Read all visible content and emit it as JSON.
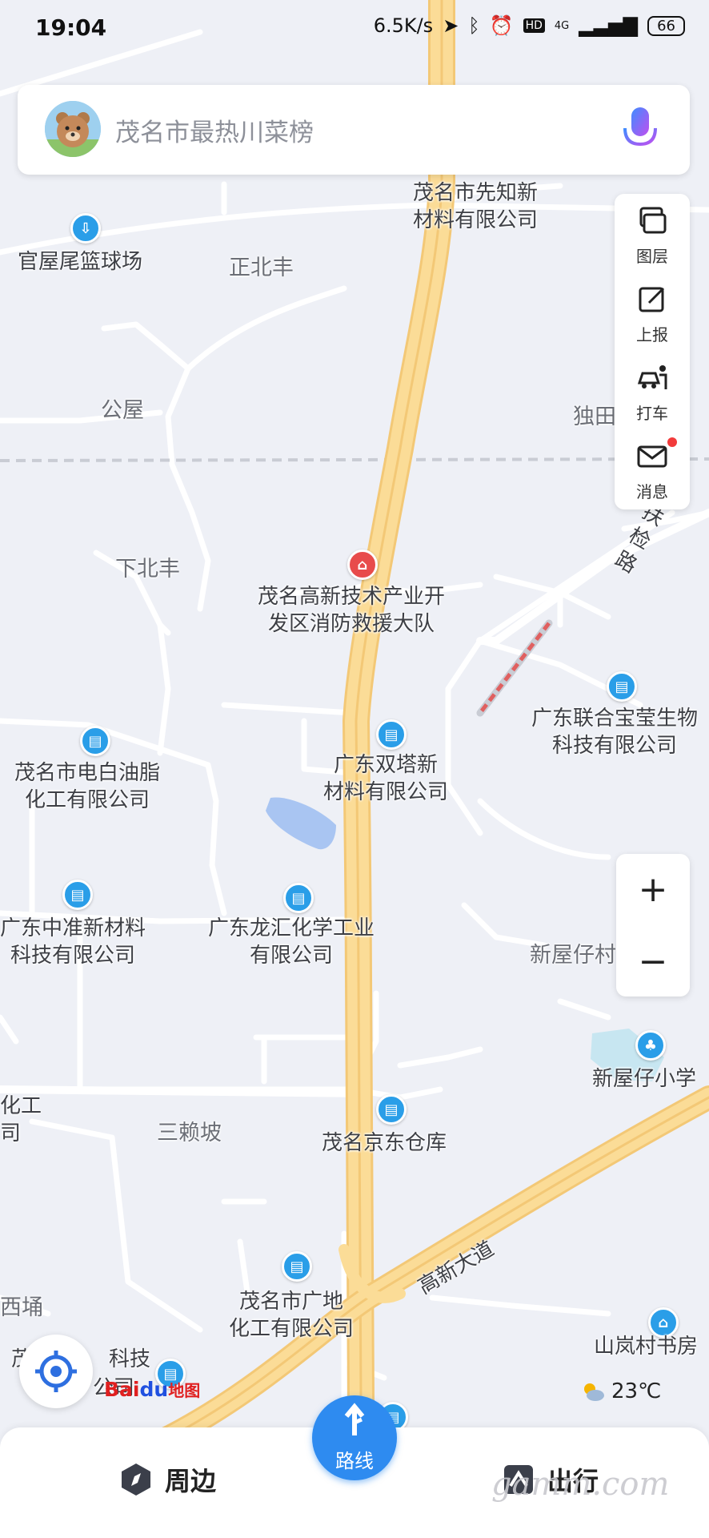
{
  "status_bar": {
    "time": "19:04",
    "net_speed": "6.5K/s",
    "network": "4G",
    "battery": "66"
  },
  "search": {
    "placeholder": "茂名市最热川菜榜"
  },
  "tools": [
    {
      "label": "图层",
      "icon": "layers-icon"
    },
    {
      "label": "上报",
      "icon": "report-icon"
    },
    {
      "label": "打车",
      "icon": "taxi-icon"
    },
    {
      "label": "消息",
      "icon": "message-icon",
      "badge": true
    }
  ],
  "map_labels": {
    "poi_1a": "茂名市先知新",
    "poi_1b": "材料有限公司",
    "court": "官屋尾篮球场",
    "place_zhengbeifeng": "正北丰",
    "place_gongwu": "公屋",
    "place_dutian": "独田",
    "road_fujian": "扶检路",
    "place_xiabeifeng": "下北丰",
    "fire_a": "茂名高新技术产业开",
    "fire_b": "发区消防救援大队",
    "bio_a": "广东联合宝莹生物",
    "bio_b": "科技有限公司",
    "shuangta_a": "广东双塔新",
    "shuangta_b": "材料有限公司",
    "dianbai_a": "茂名市电白油脂",
    "dianbai_b": "化工有限公司",
    "zhongzhun_a": "广东中准新材料",
    "zhongzhun_b": "科技有限公司",
    "longhui_a": "广东龙汇化学工业",
    "longhui_b": "有限公司",
    "place_xinwuzai": "新屋仔村",
    "school": "新屋仔小学",
    "edge_a": "化工",
    "edge_b": "司",
    "place_sanlaipo": "三赖坡",
    "jd": "茂名京东仓库",
    "road_gaoxin": "高新大道",
    "edge_c": "西埇",
    "guangdi_a": "茂名市广地",
    "guangdi_b": "化工有限公司",
    "edge_d": "茂",
    "edge_e": "科技",
    "edge_f": "公司",
    "library": "山岚村书房"
  },
  "zoom": {
    "plus": "+",
    "minus": "−"
  },
  "logo": {
    "bai": "Bai",
    "du": "du",
    "map": "地图"
  },
  "weather": {
    "temp": "23℃",
    "icon": "sun-cloud-icon"
  },
  "bottom_nav": {
    "nearby": "周边",
    "route": "路线",
    "travel": "出行"
  },
  "watermark": "gamm.com",
  "colors": {
    "accent": "#2e8bf0",
    "road_main": "#fbdc97",
    "poi_blue": "#2a9ee8",
    "poi_red": "#e84b4b"
  }
}
